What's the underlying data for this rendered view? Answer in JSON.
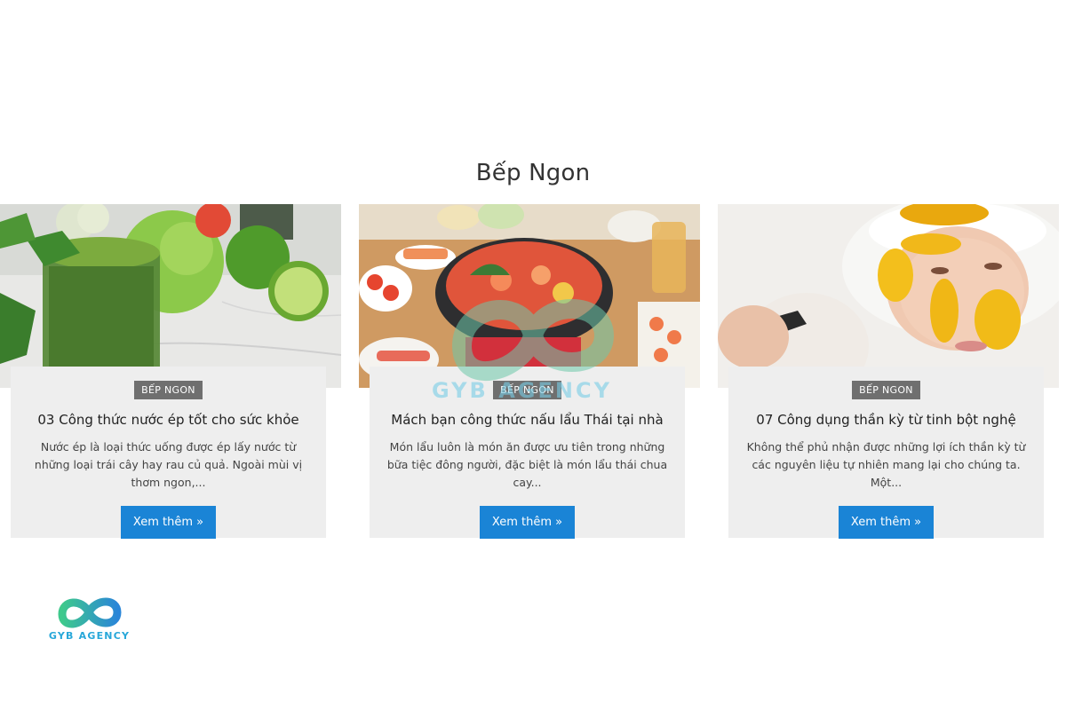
{
  "section": {
    "title": "Bếp Ngon"
  },
  "posts": [
    {
      "category": "BẾP NGON",
      "title": "03 Công thức nước ép tốt cho sức khỏe",
      "excerpt": "Nước ép là loại thức uống được ép lấy nước từ những loại trái cây hay rau củ quả. Ngoài mùi vị thơm ngon,...",
      "button": "Xem thêm »",
      "image": "green-juice-photo"
    },
    {
      "category": "BẾP NGON",
      "title": "Mách bạn công thức nấu lẩu Thái tại nhà",
      "excerpt": "Món lẩu luôn là món ăn được ưu tiên trong những bữa tiệc đông người, đặc biệt là món lẩu thái chua cay...",
      "button": "Xem thêm »",
      "image": "thai-hotpot-photo"
    },
    {
      "category": "BẾP NGON",
      "title": "07 Công dụng thần kỳ từ tinh bột nghệ",
      "excerpt": "Không thể phủ nhận được những lợi ích thần kỳ từ các nguyên liệu tự nhiên mang lại cho chúng ta. Một...",
      "button": "Xem thêm »",
      "image": "turmeric-mask-photo"
    }
  ],
  "watermark": {
    "text": "GYB AGENCY"
  },
  "logo": {
    "text": "GYB AGENCY"
  },
  "colors": {
    "button": "#1a84d6",
    "badge": "#6f6f6f",
    "card": "#eeeeee",
    "brand_teal": "#27a7d9",
    "brand_green": "#3ec98c"
  }
}
